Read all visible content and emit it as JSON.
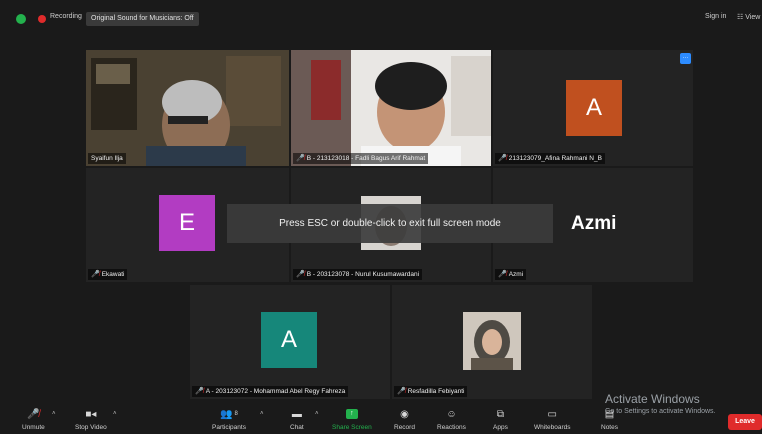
{
  "topbar": {
    "recording_label": "Recording",
    "original_sound": "Original Sound for Musicians: Off",
    "sign_in": "Sign in",
    "view": "View"
  },
  "overlay": {
    "esc_message": "Press ESC or double-click to exit full screen mode"
  },
  "participants": [
    {
      "name": "Syaifun Ilja",
      "muted": false,
      "type": "video"
    },
    {
      "name": "B - 213123018 - Fadli Bagus Arif Rahmat",
      "muted": true,
      "type": "video"
    },
    {
      "name": "213123079_Afina Rahmani N_B",
      "muted": true,
      "type": "avatar",
      "initial": "A",
      "color": "#c0501f"
    },
    {
      "name": "Ekawati",
      "muted": true,
      "type": "avatar",
      "initial": "E",
      "color": "#b23cc2"
    },
    {
      "name": "B - 203123078 - Nurul Kusumawardani",
      "muted": true,
      "type": "video"
    },
    {
      "name": "Azmi",
      "muted": true,
      "type": "name",
      "display": "Azmi"
    },
    {
      "name": "A - 203123072 - Mohammad Abel Regy Fahreza",
      "muted": true,
      "type": "avatar",
      "initial": "A",
      "color": "#16877a"
    },
    {
      "name": "Resfadilla Febiyanti",
      "muted": true,
      "type": "video"
    }
  ],
  "toolbar": {
    "unmute": "Unmute",
    "stop_video": "Stop Video",
    "participants": "Participants",
    "participants_count": "8",
    "chat": "Chat",
    "share_screen": "Share Screen",
    "record": "Record",
    "reactions": "Reactions",
    "apps": "Apps",
    "whiteboards": "Whiteboards",
    "notes": "Notes",
    "leave": "Leave"
  },
  "watermark": {
    "title": "Activate Windows",
    "subtitle": "Go to Settings to activate Windows."
  },
  "colors": {
    "accent_green": "#23b14d",
    "share_green": "#23b14d",
    "leave_red": "#e02b2b",
    "active_speaker": "#d4e157"
  }
}
